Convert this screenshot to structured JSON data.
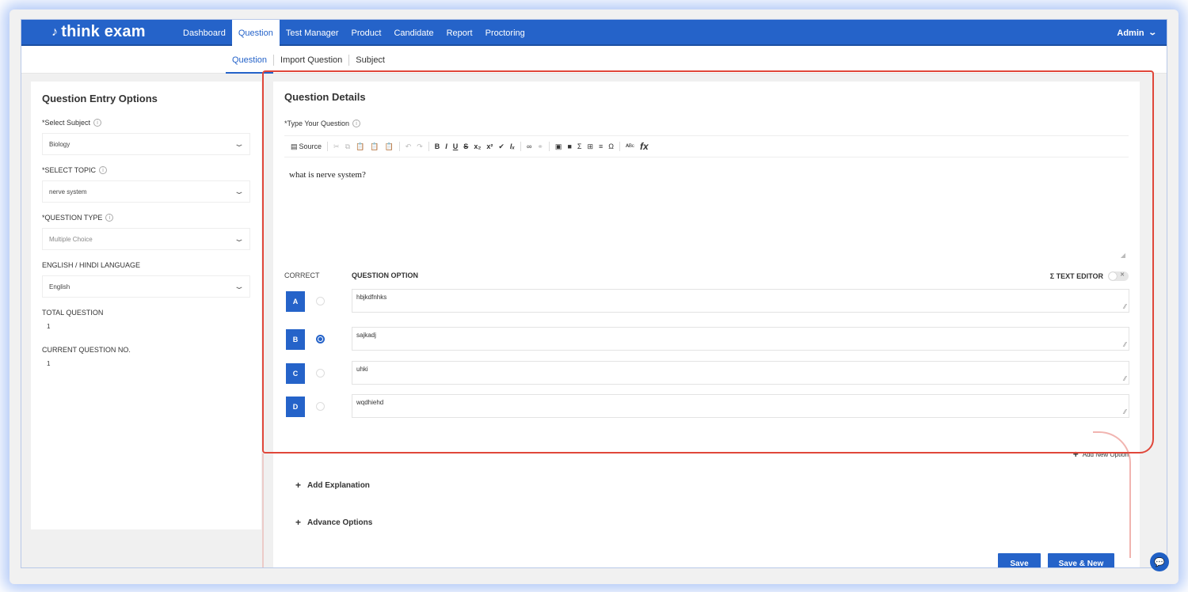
{
  "header": {
    "logo_text": "think exam",
    "nav": [
      "Dashboard",
      "Question",
      "Test Manager",
      "Product",
      "Candidate",
      "Report",
      "Proctoring"
    ],
    "active_nav": "Question",
    "user_label": "Admin"
  },
  "subnav": {
    "tabs": [
      "Question",
      "Import Question",
      "Subject"
    ],
    "active": "Question"
  },
  "left": {
    "title": "Question Entry Options",
    "subject_label": "*Select Subject",
    "subject_value": "Biology",
    "topic_label": "*SELECT TOPIC",
    "topic_value": "nerve system",
    "type_label": "*QUESTION TYPE",
    "type_value": "Multiple Choice",
    "language_label": "ENGLISH / HINDI LANGUAGE",
    "language_value": "English",
    "total_label": "TOTAL QUESTION",
    "total_value": "1",
    "current_label": "CURRENT QUESTION NO.",
    "current_value": "1"
  },
  "details": {
    "title": "Question Details",
    "question_label": "*Type Your Question",
    "toolbar_source": "Source",
    "question_text": "what is nerve system?",
    "correct_header": "CORRECT",
    "option_header": "QUESTION OPTION",
    "text_editor_label": "Σ TEXT EDITOR",
    "options": [
      {
        "letter": "A",
        "text": "hbjkdfnhks",
        "correct": false
      },
      {
        "letter": "B",
        "text": "sajkadj",
        "correct": true
      },
      {
        "letter": "C",
        "text": "uhki",
        "correct": false
      },
      {
        "letter": "D",
        "text": "wqdhiehd",
        "correct": false
      }
    ],
    "add_option_label": "Add New Option",
    "add_explanation_label": "Add Explanation",
    "advance_options_label": "Advance Options",
    "save_label": "Save",
    "save_new_label": "Save & New"
  }
}
